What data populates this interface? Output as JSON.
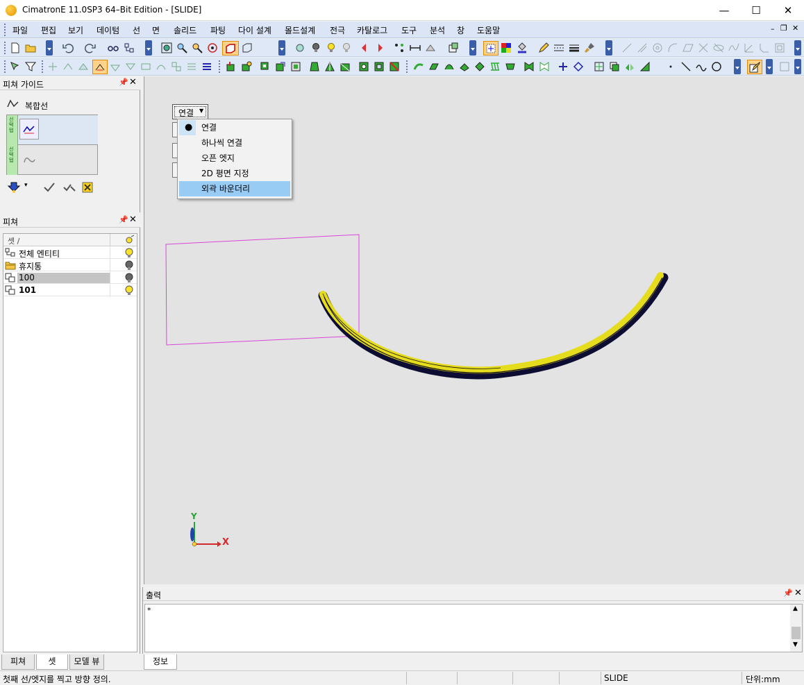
{
  "window": {
    "title": "CimatronE 11.0SP3 64–Bit Edition - [SLIDE]",
    "minimize": "—",
    "maximize": "☐",
    "close": "✕"
  },
  "menu": {
    "items": [
      "파일",
      "편집",
      "보기",
      "데이텀",
      "선",
      "면",
      "솔리드",
      "파팅",
      "다이 설계",
      "몰드설계",
      "전극",
      "카탈로그",
      "도구",
      "분석",
      "창",
      "도움말"
    ],
    "mdi_min": "–",
    "mdi_restore": "❐",
    "mdi_close": "✕"
  },
  "feature_guide": {
    "title": "피쳐 가이드",
    "pin": "P",
    "close": "✕",
    "heading": "복합선",
    "step1_tab": "선택탭",
    "step2_tab": "선택탭"
  },
  "feature_tree": {
    "title": "피쳐",
    "column_header": "셋 /",
    "rows": [
      {
        "label": "전체 엔티티",
        "bold": false,
        "selected": false,
        "bulb": "on"
      },
      {
        "label": "휴지통",
        "bold": false,
        "selected": false,
        "bulb": "off"
      },
      {
        "label": "100",
        "bold": false,
        "selected": true,
        "bulb": "off"
      },
      {
        "label": "101",
        "bold": true,
        "selected": false,
        "bulb": "on"
      }
    ]
  },
  "left_tabs": [
    "피쳐",
    "셋",
    "모델 뷰"
  ],
  "viewport": {
    "combo_value": "연결",
    "dropdown": [
      {
        "label": "연결",
        "checked": true,
        "highlighted": false
      },
      {
        "label": "하나씩 연결",
        "checked": false,
        "highlighted": false
      },
      {
        "label": "오픈 엣지",
        "checked": false,
        "highlighted": false
      },
      {
        "label": "2D 평면 지정",
        "checked": false,
        "highlighted": false
      },
      {
        "label": "외곽 바운더리",
        "checked": false,
        "highlighted": true
      }
    ],
    "axis_x": "X",
    "axis_y": "Y",
    "colors": {
      "background": "#e3e3e3",
      "part": "#e6dc1e",
      "box": "#d946d8"
    }
  },
  "output": {
    "title": "출력",
    "text": "*",
    "tab": "정보"
  },
  "status": {
    "message": "첫째 선/엣지를 찍고 방향 정의.",
    "model": "SLIDE",
    "units": "단위:mm"
  }
}
